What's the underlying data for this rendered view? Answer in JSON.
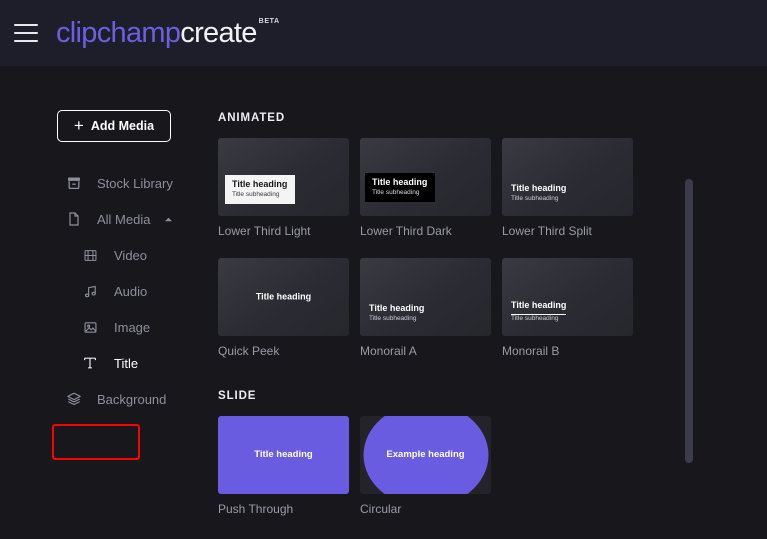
{
  "header": {
    "menu_icon": "hamburger-menu-icon",
    "logo_brand": "clipchamp",
    "logo_word": "create",
    "badge": "BETA"
  },
  "sidebar": {
    "add_media": {
      "label": "Add Media",
      "icon": "plus-icon",
      "plus": "+"
    },
    "items": [
      {
        "label": "Stock Library",
        "icon": "stock-library-icon",
        "level": 1,
        "active": false
      },
      {
        "label": "All Media",
        "icon": "document-icon",
        "level": 1,
        "active": false,
        "chevron": "chevron-up-icon"
      },
      {
        "label": "Video",
        "icon": "film-strip-icon",
        "level": 2,
        "active": false
      },
      {
        "label": "Audio",
        "icon": "music-note-icon",
        "level": 2,
        "active": false
      },
      {
        "label": "Image",
        "icon": "image-icon",
        "level": 2,
        "active": false
      },
      {
        "label": "Title",
        "icon": "text-title-icon",
        "level": 2,
        "active": true,
        "highlighted": true
      },
      {
        "label": "Background",
        "icon": "layers-icon",
        "level": 1,
        "active": false
      }
    ]
  },
  "main": {
    "sections": [
      {
        "title": "ANIMATED",
        "cards": [
          {
            "label": "Lower Third Light",
            "style": "box-light",
            "heading": "Title heading",
            "subheading": "Title subheading"
          },
          {
            "label": "Lower Third Dark",
            "style": "box-dark",
            "heading": "Title heading",
            "subheading": "Title subheading"
          },
          {
            "label": "Lower Third Split",
            "style": "plain-left",
            "heading": "Title heading",
            "subheading": "Title subheading"
          },
          {
            "label": "Quick Peek",
            "style": "center-only",
            "heading": "Title heading",
            "subheading": ""
          },
          {
            "label": "Monorail A",
            "style": "plain-left",
            "heading": "Title heading",
            "subheading": "Title subheading"
          },
          {
            "label": "Monorail B",
            "style": "plain-left-underline",
            "heading": "Title heading",
            "subheading": "Title subheading"
          }
        ]
      },
      {
        "title": "SLIDE",
        "cards": [
          {
            "label": "Push Through",
            "style": "purple-rect",
            "heading": "Title heading",
            "subheading": ""
          },
          {
            "label": "Circular",
            "style": "purple-circle",
            "heading": "Example heading",
            "subheading": ""
          }
        ]
      }
    ]
  },
  "scrollbar": {
    "name": "vertical-scrollbar"
  },
  "colors": {
    "brand_purple": "#6b5fe0",
    "header_bg": "#1e1e2a",
    "body_bg": "#18181c",
    "highlight_red": "#ff0000",
    "thumb_purple": "#6a5ce0"
  }
}
